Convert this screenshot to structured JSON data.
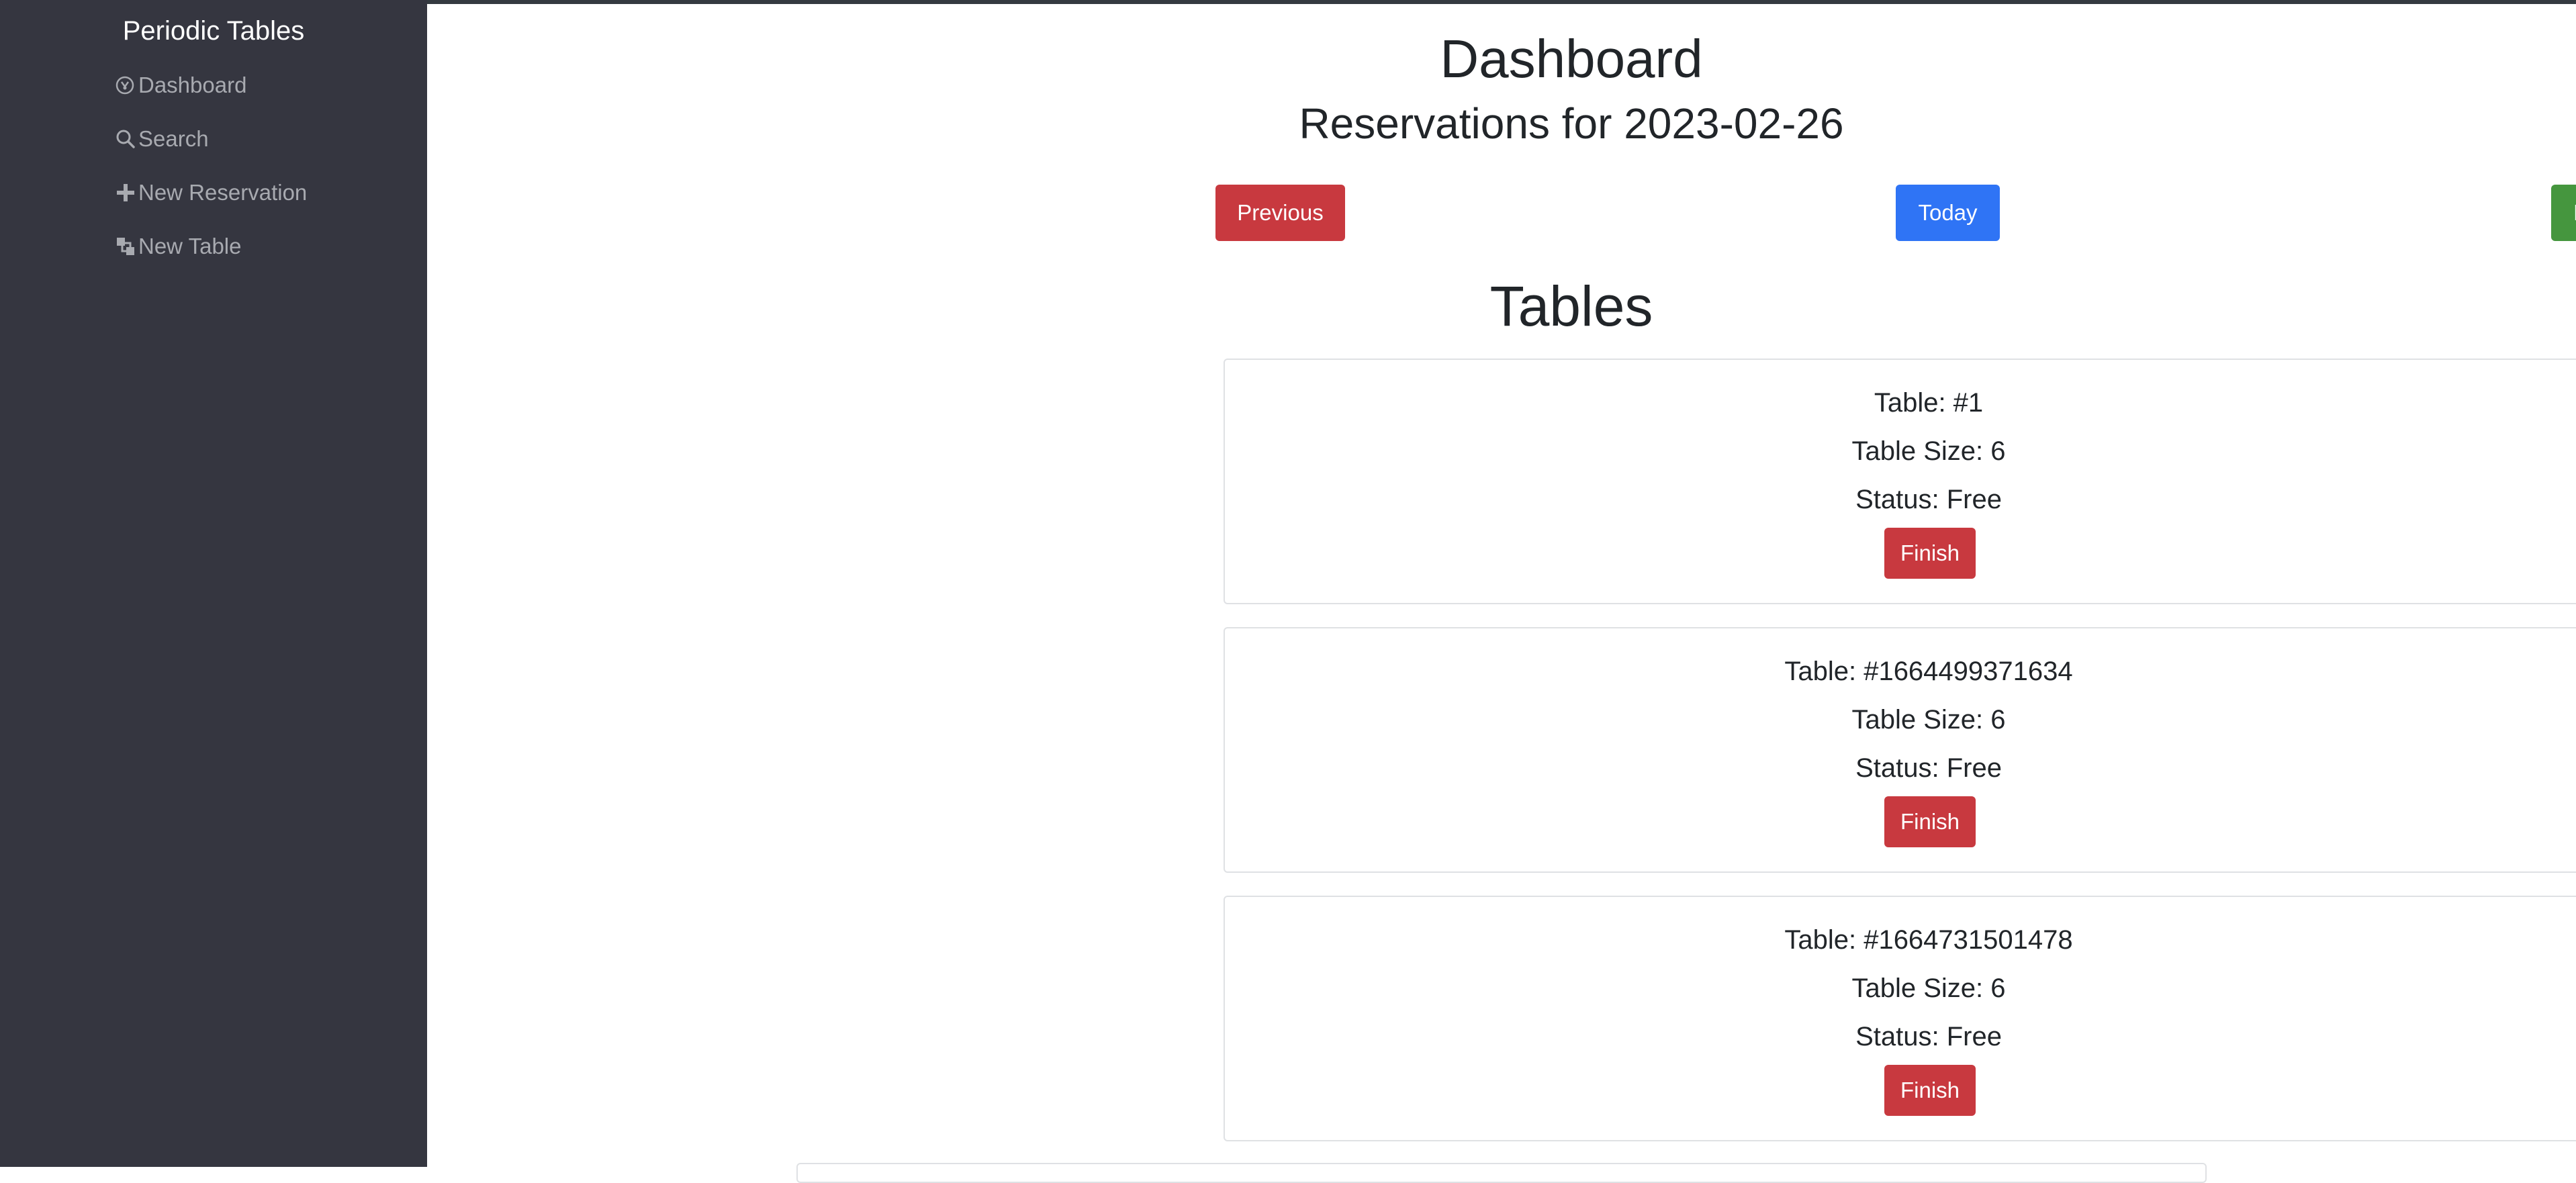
{
  "sidebar": {
    "brand": "Periodic Tables",
    "items": [
      {
        "label": "Dashboard",
        "icon": "dashboard-icon"
      },
      {
        "label": "Search",
        "icon": "search-icon"
      },
      {
        "label": "New Reservation",
        "icon": "plus-icon"
      },
      {
        "label": "New Table",
        "icon": "layers-icon"
      }
    ]
  },
  "main": {
    "title": "Dashboard",
    "subtitle": "Reservations for 2023-02-26",
    "buttons": {
      "previous": "Previous",
      "today": "Today",
      "next": "Next"
    },
    "tables_heading": "Tables",
    "tables": [
      {
        "name": "Table: #1",
        "size": "Table Size: 6",
        "status": "Status: Free",
        "action": "Finish"
      },
      {
        "name": "Table: #1664499371634",
        "size": "Table Size: 6",
        "status": "Status: Free",
        "action": "Finish"
      },
      {
        "name": "Table: #1664731501478",
        "size": "Table Size: 6",
        "status": "Status: Free",
        "action": "Finish"
      }
    ]
  },
  "colors": {
    "sidebar_bg": "#353640",
    "previous_button": "#c8393f",
    "today_button": "#2f74f5",
    "next_button": "#45963e",
    "finish_button": "#c8393f"
  }
}
